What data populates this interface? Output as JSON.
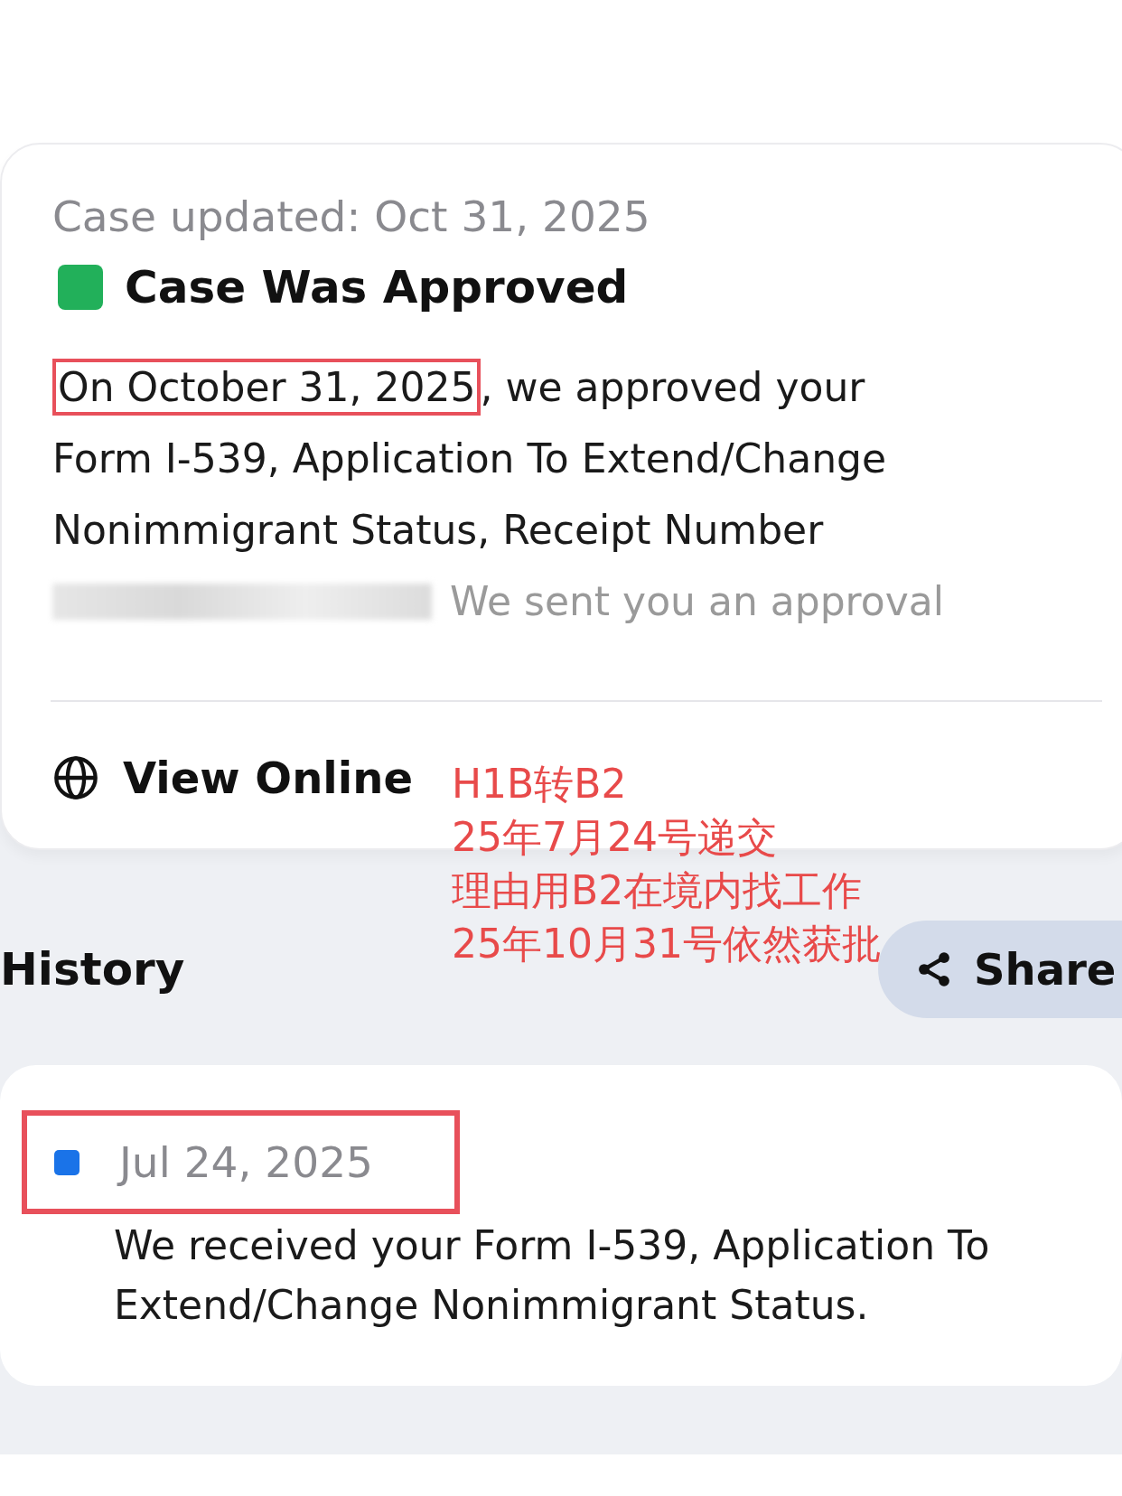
{
  "case": {
    "updated": "Case updated: Oct 31, 2025",
    "status": {
      "text": "Case Was Approved",
      "color": "#22b05a"
    },
    "message_highlight": "On October 31, 2025",
    "message_rest": ", we approved your Form I-539, Application To Extend/Change Nonimmigrant Status, Receipt Number",
    "message_tail": "We sent you an approval",
    "view_online": "View Online"
  },
  "annotation": [
    "H1B转B2",
    "25年7月24号递交",
    "理由用B2在境内找工作",
    "25年10月31号依然获批"
  ],
  "history": {
    "title": "History",
    "share": "Share",
    "items": [
      {
        "date": "Jul 24, 2025",
        "color": "#1a73e8",
        "text": "We received your Form I-539, Application To Extend/Change Nonimmigrant Status."
      }
    ]
  }
}
